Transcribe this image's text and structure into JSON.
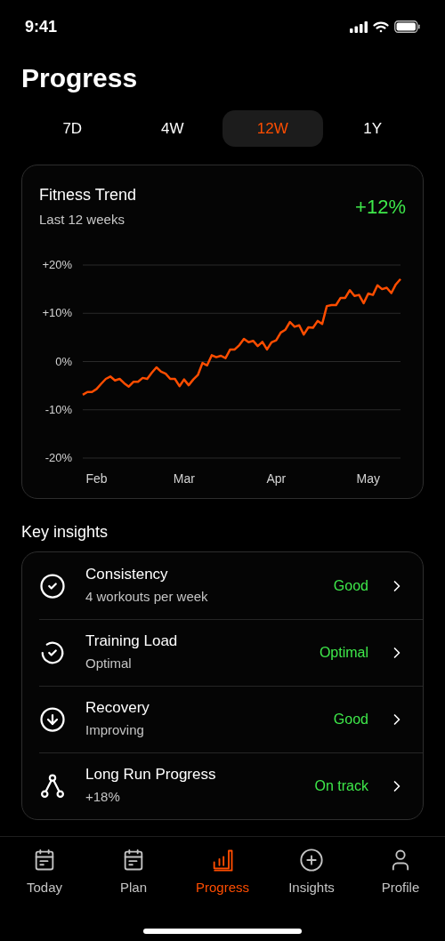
{
  "status_bar": {
    "time": "9:41"
  },
  "title": "Progress",
  "range_tabs": [
    {
      "label": "7D",
      "selected": false
    },
    {
      "label": "4W",
      "selected": false
    },
    {
      "label": "12W",
      "selected": true
    },
    {
      "label": "1Y",
      "selected": false
    }
  ],
  "trend_card": {
    "title": "Fitness Trend",
    "subtitle": "Last 12 weeks",
    "change": "+12%",
    "chart_data": {
      "type": "line",
      "grid": true,
      "categories": [
        null,
        null,
        null,
        "Feb",
        null,
        null,
        null,
        null,
        null,
        null,
        null,
        null,
        null,
        null,
        null,
        null,
        null,
        null,
        null,
        null,
        null,
        null,
        "Mar",
        null,
        null,
        null,
        null,
        null,
        null,
        null,
        null,
        null,
        null,
        null,
        null,
        null,
        null,
        null,
        null,
        null,
        null,
        null,
        "Apr",
        null,
        null,
        null,
        null,
        null,
        null,
        null,
        null,
        null,
        null,
        null,
        null,
        null,
        null,
        null,
        null,
        null,
        null,
        null,
        "May",
        null,
        null,
        null,
        null,
        null,
        null,
        null
      ],
      "ylim": [
        -20,
        20
      ],
      "yticks": [
        {
          "value": 20,
          "label": "+20%"
        },
        {
          "value": 10,
          "label": "+10%"
        },
        {
          "value": 0,
          "label": "0%"
        },
        {
          "value": -10,
          "label": "-10%"
        },
        {
          "value": -20,
          "label": "-20%"
        }
      ],
      "series": [
        {
          "color": "#ff4d00",
          "values": [
            -6.9,
            -6.3,
            -6.3,
            -5.7,
            -4.6,
            -3.6,
            -3.1,
            -3.9,
            -3.6,
            -4.5,
            -5.2,
            -4.2,
            -4.2,
            -3.4,
            -3.6,
            -2.3,
            -1.2,
            -2.1,
            -2.5,
            -3.6,
            -3.6,
            -5.1,
            -3.7,
            -4.9,
            -3.7,
            -2.8,
            -0.3,
            -0.8,
            1.3,
            0.9,
            1.2,
            0.7,
            2.5,
            2.5,
            3.4,
            4.7,
            4.0,
            4.3,
            3.2,
            4.1,
            2.5,
            4.0,
            4.4,
            6.0,
            6.6,
            8.2,
            7.2,
            7.5,
            5.6,
            7.1,
            7.0,
            8.4,
            7.8,
            11.5,
            11.7,
            11.7,
            13.2,
            13.2,
            14.8,
            13.6,
            13.8,
            12.1,
            14.1,
            13.8,
            15.8,
            15.0,
            15.3,
            14.2,
            16.0,
            17.1
          ]
        }
      ]
    }
  },
  "insights": {
    "title": "Key insights",
    "items": [
      {
        "kind": "check",
        "name": "Consistency",
        "detail": "4 workouts per week",
        "status": "Good"
      },
      {
        "kind": "load",
        "name": "Training Load",
        "detail": "Optimal",
        "status": "Optimal"
      },
      {
        "kind": "recovery",
        "name": "Recovery",
        "detail": "Improving",
        "status": "Good"
      },
      {
        "kind": "branch",
        "name": "Long Run Progress",
        "detail": "+18%",
        "status": "On track"
      }
    ]
  },
  "nav": [
    {
      "kind": "calendar",
      "label": "Today",
      "selected": false
    },
    {
      "kind": "calendar",
      "label": "Plan",
      "selected": false
    },
    {
      "kind": "chart",
      "label": "Progress",
      "selected": true
    },
    {
      "kind": "plus",
      "label": "Insights",
      "selected": false
    },
    {
      "kind": "user",
      "label": "Profile",
      "selected": false
    }
  ]
}
